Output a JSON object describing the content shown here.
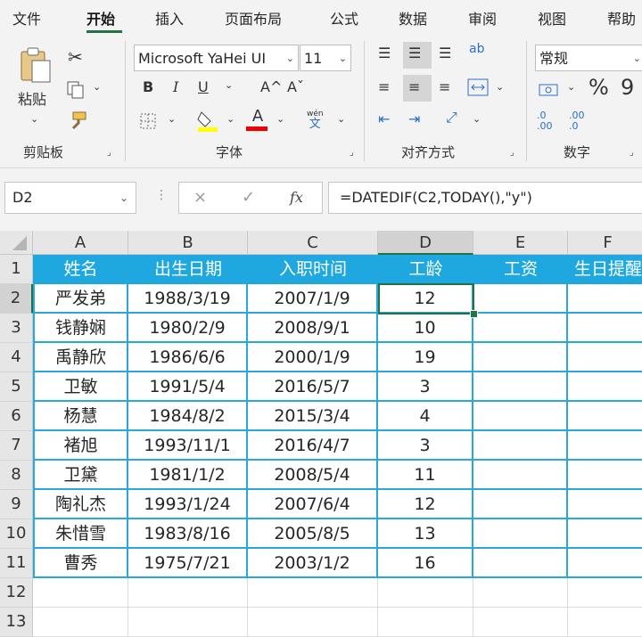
{
  "menu": {
    "tabs": [
      "文件",
      "开始",
      "插入",
      "页面布局",
      "公式",
      "数据",
      "审阅",
      "视图",
      "帮助"
    ],
    "active": "开始"
  },
  "ribbon": {
    "clipboard": {
      "paste_label": "粘贴",
      "group_label": "剪贴板"
    },
    "font": {
      "name": "Microsoft YaHei UI",
      "size": "11",
      "bold": "B",
      "italic": "I",
      "underline": "U",
      "grow": "A^",
      "shrink": "Aˇ",
      "font_color": "A",
      "phonetic_top": "wén",
      "phonetic_bottom": "文",
      "group_label": "字体"
    },
    "alignment": {
      "group_label": "对齐方式",
      "wrap_glyph": "ab"
    },
    "number": {
      "format": "常规",
      "percent": "%",
      "comma": "9",
      "inc_decimal": ".00",
      "dec_decimal": ".0",
      "group_label": "数字"
    }
  },
  "formula_bar": {
    "name_box": "D2",
    "cancel": "×",
    "enter": "✓",
    "fx": "fx",
    "formula": "=DATEDIF(C2,TODAY(),\"y\")"
  },
  "sheet": {
    "columns": [
      "A",
      "B",
      "C",
      "D",
      "E",
      "F"
    ],
    "rows": [
      "1",
      "2",
      "3",
      "4",
      "5",
      "6",
      "7",
      "8",
      "9",
      "10",
      "11",
      "12",
      "13"
    ],
    "header": [
      "姓名",
      "出生日期",
      "入职时间",
      "工龄",
      "工资",
      "生日提醒"
    ],
    "data": [
      [
        "严发弟",
        "1988/3/19",
        "2007/1/9",
        "12"
      ],
      [
        "钱静娴",
        "1980/2/9",
        "2008/9/1",
        "10"
      ],
      [
        "禹静欣",
        "1986/6/6",
        "2000/1/9",
        "19"
      ],
      [
        "卫敏",
        "1991/5/4",
        "2016/5/7",
        "3"
      ],
      [
        "杨慧",
        "1984/8/2",
        "2015/3/4",
        "4"
      ],
      [
        "褚旭",
        "1993/11/1",
        "2016/4/7",
        "3"
      ],
      [
        "卫黛",
        "1981/1/2",
        "2008/5/4",
        "11"
      ],
      [
        "陶礼杰",
        "1993/1/24",
        "2007/6/4",
        "12"
      ],
      [
        "朱惜雪",
        "1983/8/16",
        "2005/8/5",
        "13"
      ],
      [
        "曹秀",
        "1975/7/21",
        "2003/1/2",
        "16"
      ]
    ],
    "selected_cell": "D2"
  },
  "colors": {
    "accent": "#217346",
    "header_fill": "#1fa8e0",
    "table_border": "#29a8df"
  }
}
